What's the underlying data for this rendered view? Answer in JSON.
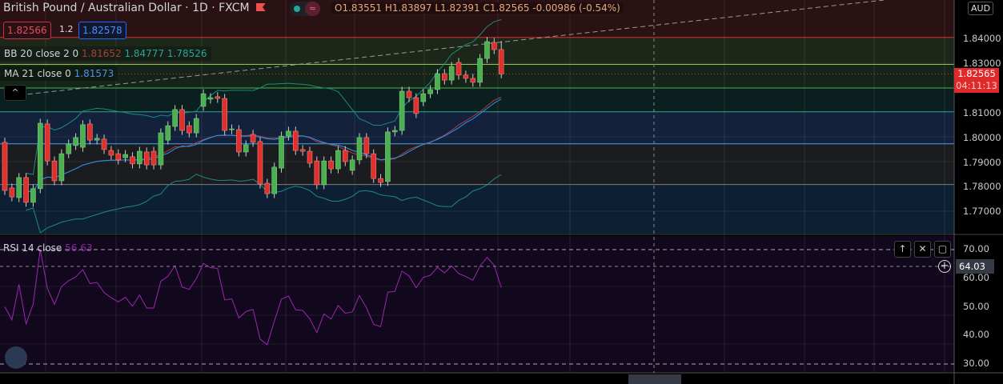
{
  "header": {
    "symbol_title": "British Pound / Australian Dollar · 1D · FXCM",
    "ohlc": "O1.83551 H1.83897 L1.82391 C1.82565 -0.00986 (-0.54%)",
    "bid": "1.82566",
    "spread": "1.2",
    "ask": "1.82578",
    "toggle_icon": "wave-icon"
  },
  "indicators": {
    "bb": {
      "label": "BB 20 close 2 0",
      "basis": "1.81652",
      "upper": "1.84777",
      "lower": "1.78526"
    },
    "ma": {
      "label": "MA 21 close 0",
      "value": "1.81573"
    },
    "rsi": {
      "label": "RSI 14 close",
      "value": "56.63"
    }
  },
  "price_axis": {
    "currency": "AUD",
    "ticks": [
      "1.84000",
      "1.83000",
      "1.81000",
      "1.80000",
      "1.79000",
      "1.78000",
      "1.77000"
    ],
    "last_price": "1.82565",
    "countdown": "04:11:13"
  },
  "rsi_axis": {
    "ticks": [
      "70.00",
      "60.00",
      "50.00",
      "40.00",
      "30.00"
    ],
    "crosshair_value": "64.03"
  },
  "colors": {
    "up": "#4caf50",
    "down": "#e0302c",
    "bb": "#1e8a80",
    "ma": "#2196f3",
    "rsi": "#9c27b0"
  },
  "chart_data": {
    "type": "candlestick",
    "price_range": [
      1.7655,
      1.8555
    ],
    "rsi_range": [
      30,
      70
    ],
    "last_candle": {
      "open": 1.83551,
      "high": 1.83897,
      "low": 1.82391,
      "close": 1.82565
    },
    "candles": [
      [
        1.7981,
        1.7787
      ],
      [
        1.7797,
        1.7761
      ],
      [
        1.7758,
        1.7839
      ],
      [
        1.7839,
        1.7739
      ],
      [
        1.7739,
        1.7794
      ],
      [
        1.7794,
        1.8058
      ],
      [
        1.8055,
        1.7906
      ],
      [
        1.7906,
        1.7826
      ],
      [
        1.7826,
        1.7935
      ],
      [
        1.7935,
        1.7974
      ],
      [
        1.7968,
        1.8
      ],
      [
        1.7961,
        1.8052
      ],
      [
        1.8055,
        1.799
      ],
      [
        1.799,
        1.7997
      ],
      [
        1.7994,
        1.7952
      ],
      [
        1.7948,
        1.7929
      ],
      [
        1.7935,
        1.791
      ],
      [
        1.7919,
        1.7932
      ],
      [
        1.7923,
        1.7894
      ],
      [
        1.7894,
        1.7945
      ],
      [
        1.7942,
        1.789
      ],
      [
        1.7945,
        1.789
      ],
      [
        1.789,
        1.8019
      ],
      [
        1.799,
        1.8048
      ],
      [
        1.8045,
        1.8113
      ],
      [
        1.8113,
        1.8029
      ],
      [
        1.8048,
        1.8019
      ],
      [
        1.8019,
        1.8077
      ],
      [
        1.8126,
        1.8177
      ],
      [
        1.8155,
        1.8161
      ],
      [
        1.8165,
        1.8158
      ],
      [
        1.8158,
        1.8029
      ],
      [
        1.8032,
        1.8035
      ],
      [
        1.8032,
        1.7942
      ],
      [
        1.7942,
        1.7971
      ],
      [
        1.8013,
        1.7981
      ],
      [
        1.7984,
        1.7813
      ],
      [
        1.7816,
        1.7774
      ],
      [
        1.7774,
        1.7881
      ],
      [
        1.7877,
        1.8006
      ],
      [
        1.8006,
        1.8026
      ],
      [
        1.8026,
        1.7948
      ],
      [
        1.7952,
        1.7945
      ],
      [
        1.7945,
        1.7897
      ],
      [
        1.7906,
        1.781
      ],
      [
        1.781,
        1.7906
      ],
      [
        1.7906,
        1.7874
      ],
      [
        1.7874,
        1.7948
      ],
      [
        1.7948,
        1.7903
      ],
      [
        1.7868,
        1.791
      ],
      [
        1.791,
        1.8
      ],
      [
        1.8,
        1.7935
      ],
      [
        1.7935,
        1.7835
      ],
      [
        1.7835,
        1.7819
      ],
      [
        1.7823,
        1.8023
      ],
      [
        1.8023,
        1.8029
      ],
      [
        1.8029,
        1.8187
      ],
      [
        1.8187,
        1.8161
      ],
      [
        1.8161,
        1.8097
      ],
      [
        1.8145,
        1.8177
      ],
      [
        1.8177,
        1.8194
      ],
      [
        1.8194,
        1.8258
      ],
      [
        1.8258,
        1.8232
      ],
      [
        1.8232,
        1.8287
      ],
      [
        1.8303,
        1.8252
      ],
      [
        1.8252,
        1.8239
      ],
      [
        1.8239,
        1.8223
      ],
      [
        1.8223,
        1.8319
      ],
      [
        1.8319,
        1.8387
      ],
      [
        1.8384,
        1.8355
      ],
      [
        1.83551,
        1.82565
      ]
    ],
    "horizontal_levels": [
      1.8404,
      1.8295,
      1.82,
      1.8104,
      1.7975,
      1.7811
    ],
    "trendline": [
      [
        1,
        1.8168
      ],
      [
        124,
        1.8555
      ]
    ]
  }
}
